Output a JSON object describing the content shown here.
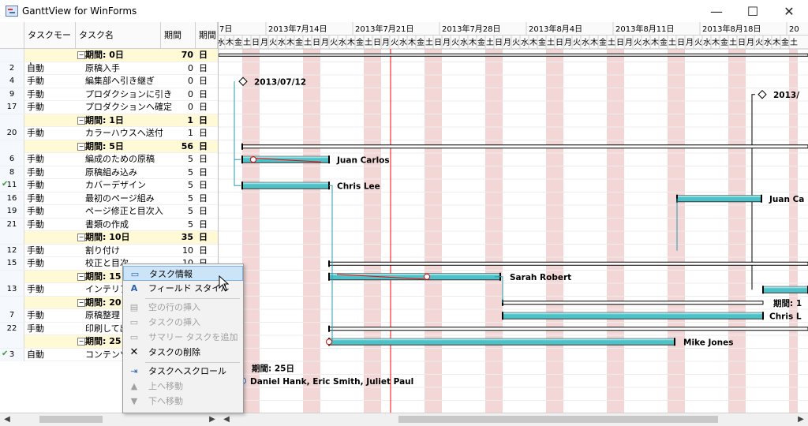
{
  "window": {
    "title": "GanttView for WinForms"
  },
  "grid": {
    "columns": [
      "タスクモード",
      "タスク名",
      "期間",
      "期間"
    ],
    "rows": [
      {
        "num": "",
        "mode": "",
        "name": "期間: 0日",
        "dur": "70",
        "unit": "日",
        "group": true
      },
      {
        "num": "2",
        "mode": "自動",
        "name": "原稿入手",
        "dur": "0",
        "unit": "日"
      },
      {
        "num": "4",
        "mode": "手動",
        "name": "編集部へ引き継ぎ",
        "dur": "0",
        "unit": "日"
      },
      {
        "num": "9",
        "mode": "手動",
        "name": "プロダクションに引き",
        "dur": "0",
        "unit": "日"
      },
      {
        "num": "17",
        "mode": "手動",
        "name": "プロダクションへ確定",
        "dur": "0",
        "unit": "日"
      },
      {
        "num": "",
        "mode": "",
        "name": "期間: 1日",
        "dur": "1",
        "unit": "日",
        "group": true
      },
      {
        "num": "20",
        "mode": "手動",
        "name": "カラーハウスへ送付",
        "dur": "1",
        "unit": "日"
      },
      {
        "num": "",
        "mode": "",
        "name": "期間: 5日",
        "dur": "56",
        "unit": "日",
        "group": true
      },
      {
        "num": "6",
        "mode": "手動",
        "name": "編成のための原稿",
        "dur": "5",
        "unit": "日"
      },
      {
        "num": "8",
        "mode": "手動",
        "name": "原稿組み込み",
        "dur": "5",
        "unit": "日"
      },
      {
        "num": "11",
        "mode": "手動",
        "name": "カバーデザイン",
        "dur": "5",
        "unit": "日",
        "check": true
      },
      {
        "num": "16",
        "mode": "手動",
        "name": "最初のページ組み",
        "dur": "5",
        "unit": "日"
      },
      {
        "num": "19",
        "mode": "手動",
        "name": "ページ修正と目次入",
        "dur": "5",
        "unit": "日"
      },
      {
        "num": "21",
        "mode": "手動",
        "name": "書類の作成",
        "dur": "5",
        "unit": "日"
      },
      {
        "num": "",
        "mode": "",
        "name": "期間: 10日",
        "dur": "35",
        "unit": "日",
        "group": true
      },
      {
        "num": "12",
        "mode": "手動",
        "name": "割り付け",
        "dur": "10",
        "unit": "日"
      },
      {
        "num": "15",
        "mode": "手動",
        "name": "校正と目次",
        "dur": "10",
        "unit": "日"
      },
      {
        "num": "",
        "mode": "",
        "name": "期間: 15日",
        "dur": "",
        "unit": "",
        "group": true
      },
      {
        "num": "13",
        "mode": "手動",
        "name": "インテリア",
        "dur": "",
        "unit": ""
      },
      {
        "num": "",
        "mode": "",
        "name": "期間: 20日",
        "dur": "",
        "unit": "",
        "group": true
      },
      {
        "num": "7",
        "mode": "手動",
        "name": "原稿整理",
        "dur": "",
        "unit": ""
      },
      {
        "num": "22",
        "mode": "手動",
        "name": "印刷して出",
        "dur": "",
        "unit": ""
      },
      {
        "num": "",
        "mode": "",
        "name": "期間: 25日",
        "dur": "",
        "unit": "",
        "group": true
      },
      {
        "num": "3",
        "mode": "自動",
        "name": "コンテンツ",
        "dur": "",
        "unit": "",
        "check": true
      }
    ]
  },
  "timeline": {
    "weeks": [
      "7日",
      "2013年7月14日",
      "2013年7月21日",
      "2013年7月28日",
      "2013年8月4日",
      "2013年8月11日",
      "2013年8月18日",
      "20"
    ],
    "days": [
      "水",
      "木",
      "金",
      "土",
      "日",
      "月",
      "火",
      "水",
      "木",
      "金",
      "土",
      "日",
      "月",
      "火",
      "水",
      "木",
      "金",
      "土",
      "日",
      "月",
      "火",
      "水",
      "木",
      "金",
      "土",
      "日",
      "月",
      "火",
      "水",
      "木",
      "金",
      "土",
      "日",
      "月",
      "火",
      "水",
      "木",
      "金",
      "土",
      "日",
      "月",
      "火",
      "水",
      "木",
      "金",
      "土",
      "日",
      "月",
      "火",
      "水",
      "木",
      "金",
      "土",
      "日",
      "月",
      "火",
      "水",
      "木",
      "金",
      "土",
      "日",
      "月",
      "火",
      "水",
      "木",
      "金",
      "土"
    ],
    "labels": {
      "date1": "2013/07/12",
      "date2": "2013/",
      "juan1": "Juan Carlos",
      "chris1": "Chris Lee",
      "juan2": "Juan Ca",
      "sarah": "Sarah Robert",
      "kikan15": "期間: 1",
      "chris2": "Chris L",
      "mike": "Mike Jones",
      "kikan25": "期間: 25日",
      "people": "Daniel Hank, Eric Smith, Juliet Paul"
    }
  },
  "menu": {
    "items": [
      {
        "label": "タスク情報",
        "icon": "task-info-icon",
        "enabled": true,
        "selected": true
      },
      {
        "label": "フィールド スタイル",
        "icon": "field-style-icon",
        "enabled": true
      },
      {
        "label": "空の行の挿入",
        "icon": "insert-blank-row-icon",
        "enabled": false
      },
      {
        "label": "タスクの挿入",
        "icon": "insert-task-icon",
        "enabled": false
      },
      {
        "label": "サマリー タスクを追加",
        "icon": "add-summary-task-icon",
        "enabled": false
      },
      {
        "label": "タスクの削除",
        "icon": "delete-task-icon",
        "enabled": true
      },
      {
        "label": "タスクへスクロール",
        "icon": "scroll-to-task-icon",
        "enabled": true
      },
      {
        "label": "上へ移動",
        "icon": "move-up-icon",
        "enabled": false
      },
      {
        "label": "下へ移動",
        "icon": "move-down-icon",
        "enabled": false
      }
    ]
  },
  "colors": {
    "accent": "#4cc2c8",
    "weekend": "#f3d7d7",
    "today": "#ff0000",
    "group": "#fff9d6"
  }
}
